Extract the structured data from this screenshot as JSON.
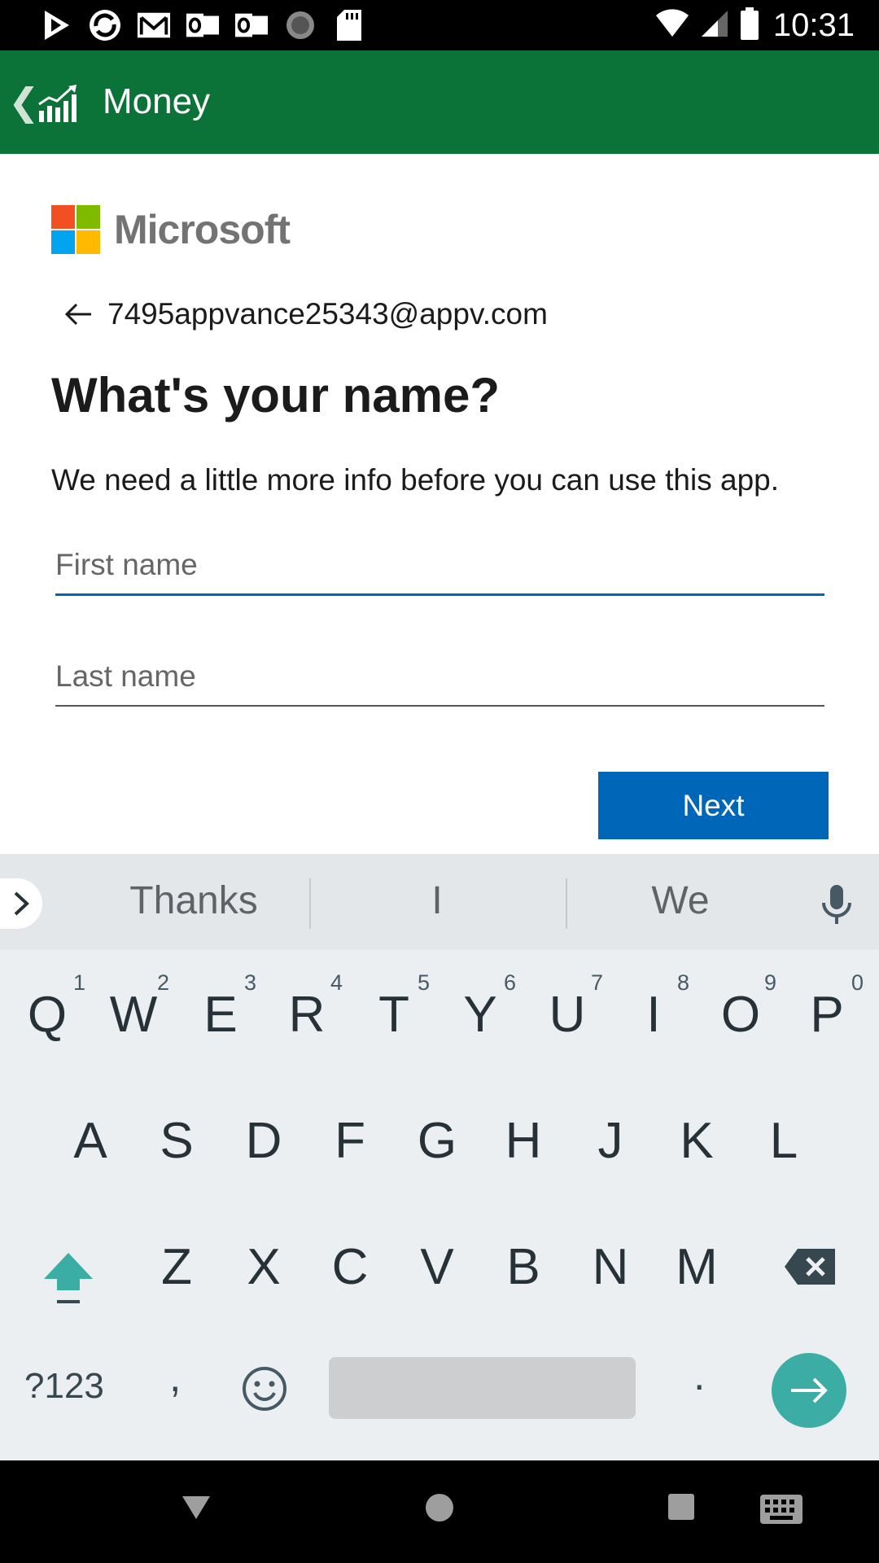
{
  "status_bar": {
    "time": "10:31",
    "icons": [
      "play-store-icon",
      "sync-icon",
      "gmail-icon",
      "outlook-icon",
      "outlook-icon",
      "loading-icon",
      "sd-card-icon"
    ],
    "right_icons": [
      "wifi-icon",
      "signal-icon",
      "battery-icon"
    ]
  },
  "app_bar": {
    "title": "Money",
    "icon": "chart-bars-icon",
    "color": "#0b7238"
  },
  "signin": {
    "brand": "Microsoft",
    "brand_colors": [
      "#f25022",
      "#7fba00",
      "#00a4ef",
      "#ffb900"
    ],
    "email": "7495appvance25343@appv.com",
    "heading": "What's your name?",
    "subtext": "We need a little more info before you can use this app.",
    "first_name": {
      "value": "",
      "placeholder": "First name"
    },
    "last_name": {
      "value": "",
      "placeholder": "Last name"
    },
    "next_label": "Next",
    "accent": "#0067b8"
  },
  "keyboard": {
    "suggestions": [
      "Thanks",
      "I",
      "We"
    ],
    "row1": [
      "Q",
      "W",
      "E",
      "R",
      "T",
      "Y",
      "U",
      "I",
      "O",
      "P"
    ],
    "row1_numbers": [
      "1",
      "2",
      "3",
      "4",
      "5",
      "6",
      "7",
      "8",
      "9",
      "0"
    ],
    "row2": [
      "A",
      "S",
      "D",
      "F",
      "G",
      "H",
      "J",
      "K",
      "L"
    ],
    "row3": [
      "Z",
      "X",
      "C",
      "V",
      "B",
      "N",
      "M"
    ],
    "symbols_label": "?123",
    "comma": ",",
    "period": ".",
    "accent": "#3bada4"
  },
  "nav_bar": {
    "buttons": [
      "back-icon",
      "home-icon",
      "recents-icon",
      "keyboard-icon"
    ]
  }
}
